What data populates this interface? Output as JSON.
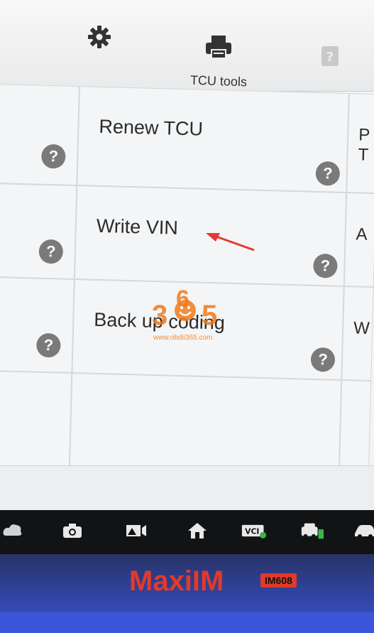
{
  "toolbar": {
    "gear_icon": "gear-icon",
    "printer_icon": "printer-icon",
    "help_icon": "help-icon",
    "title": "TCU tools"
  },
  "grid": {
    "cells": [
      {
        "label": "Renew TCU"
      },
      {
        "label": "Write VIN"
      },
      {
        "label": "Back up coding"
      }
    ],
    "right_partial": [
      "P",
      "T",
      "A",
      "W"
    ],
    "help_glyph": "?"
  },
  "watermark": {
    "digits": [
      "3",
      "6",
      "5"
    ],
    "url": "www.obdii365.com"
  },
  "navbar": {
    "icons": [
      "vci-cloud-icon",
      "camera-icon",
      "display-icon",
      "home-icon",
      "vci-icon",
      "car-shortcut-icon",
      "car-icon"
    ]
  },
  "device": {
    "brand": "MaxiIM",
    "model": "IM608"
  },
  "colors": {
    "brand_red": "#e23a2a",
    "arrow_red": "#e53935",
    "watermark_orange": "#f07a1a"
  }
}
